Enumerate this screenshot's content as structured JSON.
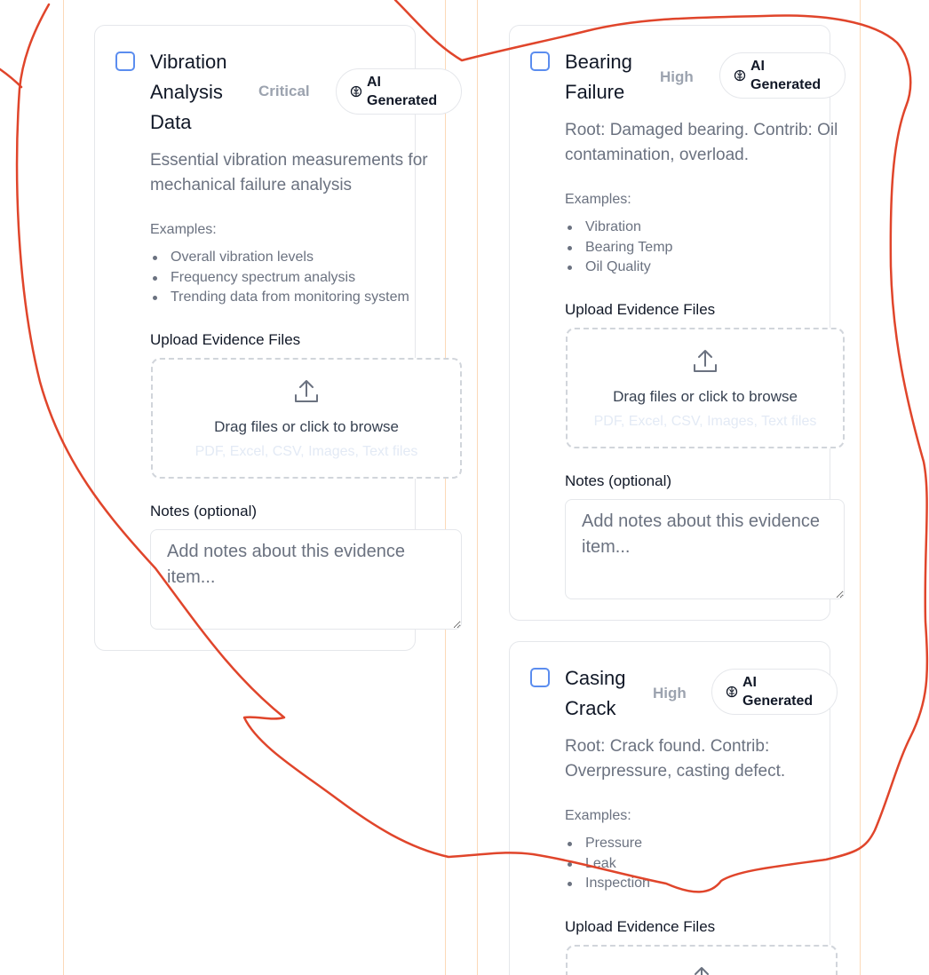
{
  "colors": {
    "checkbox": "#5b8def",
    "guide_line": "#fcd9b8",
    "annotation_stroke": "#e0452b",
    "muted_text": "#6b7280",
    "faint_text": "#e3eaf5"
  },
  "icons": {
    "badge": "brain-icon",
    "upload": "upload-icon",
    "notes_resize": "resize-handle-icon"
  },
  "cards": [
    {
      "title": "Vibration\nAnalysis\nData",
      "severity": "Critical",
      "badge": "AI\nGenerated",
      "description": "Essential vibration measurements for mechanical failure analysis",
      "examples_heading": "Examples:",
      "examples": [
        "Overall vibration levels",
        "Frequency spectrum analysis",
        "Trending data from monitoring system"
      ],
      "upload_label": "Upload Evidence Files",
      "dropzone_text": "Drag files or click to browse",
      "dropzone_hint": "PDF, Excel, CSV, Images, Text files",
      "notes_label": "Notes (optional)",
      "notes_placeholder": "Add notes about this evidence item..."
    },
    {
      "title": "Bearing\nFailure",
      "severity": "High",
      "badge": "AI\nGenerated",
      "description": "Root: Damaged bearing. Contrib: Oil contamination, overload.",
      "examples_heading": "Examples:",
      "examples": [
        "Vibration",
        "Bearing Temp",
        "Oil Quality"
      ],
      "upload_label": "Upload Evidence Files",
      "dropzone_text": "Drag files or click to browse",
      "dropzone_hint": "PDF, Excel, CSV, Images, Text files",
      "notes_label": "Notes (optional)",
      "notes_placeholder": "Add notes about this evidence item..."
    },
    {
      "title": "Casing\nCrack",
      "severity": "High",
      "badge": "AI\nGenerated",
      "description": "Root: Crack found. Contrib: Overpressure, casting defect.",
      "examples_heading": "Examples:",
      "examples": [
        "Pressure",
        "Leak",
        "Inspection"
      ],
      "upload_label": "Upload Evidence Files"
    }
  ]
}
